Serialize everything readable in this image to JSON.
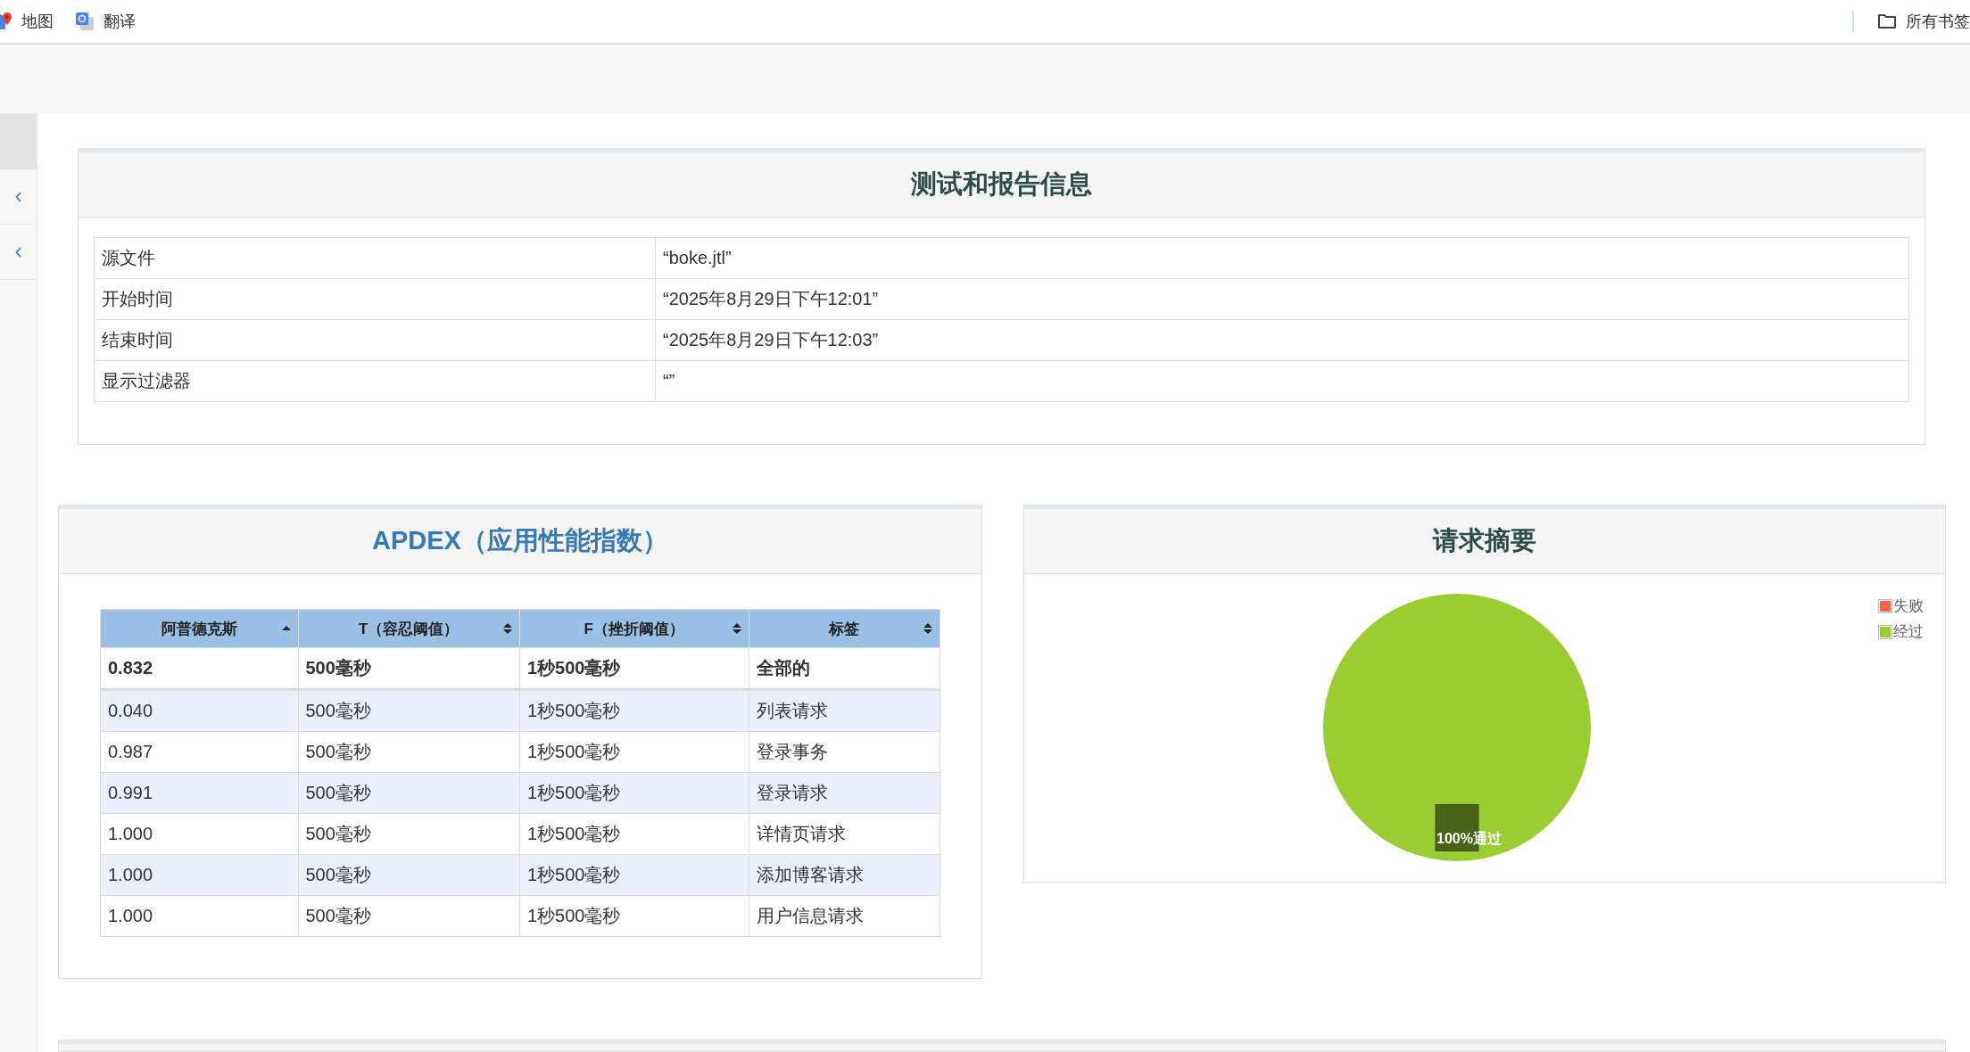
{
  "bookmarks": {
    "items": [
      {
        "kind": "map",
        "label": "地图"
      },
      {
        "kind": "translate",
        "label": "翻译"
      }
    ],
    "all_bookmarks": "所有书签"
  },
  "sidebar": {
    "items": [
      {
        "kind": "blank",
        "selected": true
      },
      {
        "kind": "collapse",
        "selected": false
      },
      {
        "kind": "collapse",
        "selected": false
      }
    ]
  },
  "info_panel": {
    "title": "测试和报告信息",
    "rows": [
      {
        "label": "源文件",
        "value": "“boke.jtl”"
      },
      {
        "label": "开始时间",
        "value": "“2025年8月29日下午12:01”"
      },
      {
        "label": "结束时间",
        "value": "“2025年8月29日下午12:03”"
      },
      {
        "label": "显示过滤器",
        "value": "“”"
      }
    ]
  },
  "apdex_panel": {
    "title": "APDEX（应用性能指数）",
    "columns": [
      {
        "label": "阿普德克斯",
        "sorted": true
      },
      {
        "label": "T（容忍阈值）",
        "sorted": false
      },
      {
        "label": "F（挫折阈值）",
        "sorted": false
      },
      {
        "label": "标签",
        "sorted": false
      }
    ],
    "rows": [
      {
        "kind": "total",
        "cells": [
          "0.832",
          "500毫秒",
          "1秒500毫秒",
          "全部的"
        ]
      },
      {
        "kind": "row",
        "cells": [
          "0.040",
          "500毫秒",
          "1秒500毫秒",
          "列表请求"
        ]
      },
      {
        "kind": "row",
        "cells": [
          "0.987",
          "500毫秒",
          "1秒500毫秒",
          "登录事务"
        ]
      },
      {
        "kind": "row",
        "cells": [
          "0.991",
          "500毫秒",
          "1秒500毫秒",
          "登录请求"
        ]
      },
      {
        "kind": "row",
        "cells": [
          "1.000",
          "500毫秒",
          "1秒500毫秒",
          "详情页请求"
        ]
      },
      {
        "kind": "row",
        "cells": [
          "1.000",
          "500毫秒",
          "1秒500毫秒",
          "添加博客请求"
        ]
      },
      {
        "kind": "row",
        "cells": [
          "1.000",
          "500毫秒",
          "1秒500毫秒",
          "用户信息请求"
        ]
      }
    ]
  },
  "summary_panel": {
    "title": "请求摘要",
    "slice_label": "100%通过",
    "chart_data": {
      "type": "pie",
      "categories": [
        "失败",
        "经过"
      ],
      "values": [
        0,
        100
      ],
      "colors": [
        "#ff6347",
        "#9acd32"
      ]
    }
  }
}
